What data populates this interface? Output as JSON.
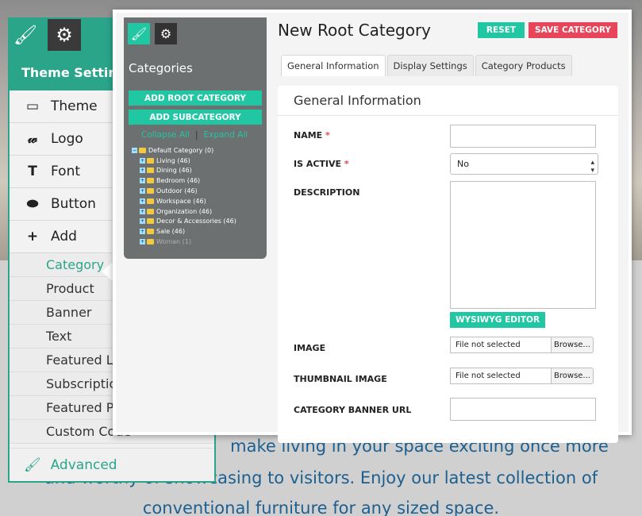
{
  "background": {
    "lines": [
      "make living in your space exciting once more",
      "and worthy of showcasing to visitors. Enjoy our latest collection of",
      "conventional furniture for any sized space."
    ]
  },
  "theme_panel": {
    "title": "Theme Setting",
    "items": [
      {
        "label": "Theme",
        "icon": "layout-icon",
        "glyph": "▭"
      },
      {
        "label": "Logo",
        "icon": "logo-script-icon",
        "glyph": "𝓌"
      },
      {
        "label": "Font",
        "icon": "font-t-icon",
        "glyph": "T"
      },
      {
        "label": "Button",
        "icon": "button-pill-icon",
        "glyph": "⬬"
      },
      {
        "label": "Add",
        "icon": "plus-icon",
        "glyph": "+"
      }
    ],
    "add_items": [
      "Category",
      "Product",
      "Banner",
      "Text",
      "Featured Lo",
      "Subscription",
      "Featured Pr",
      "Custom Code"
    ],
    "advanced_label": "Advanced"
  },
  "popup": {
    "sidebar": {
      "title": "Categories",
      "add_root_label": "ADD ROOT CATEGORY",
      "add_sub_label": "ADD SUBCATEGORY",
      "collapse_label": "Collapse All",
      "separator": "|",
      "expand_label": "Expand All",
      "tree_root": "Default Category (0)",
      "tree_children": [
        "Living (46)",
        "Dining (46)",
        "Bedroom (46)",
        "Outdoor (46)",
        "Workspace (46)",
        "Organization (46)",
        "Decor & Accessories (46)",
        "Sale (46)",
        "Woman (1)"
      ]
    },
    "title": "New Root Category",
    "reset_label": "RESET",
    "save_label": "SAVE CATEGORY",
    "tabs": [
      "General Information",
      "Display Settings",
      "Category Products"
    ],
    "form": {
      "heading": "General Information",
      "name_label": "NAME",
      "required_mark": "*",
      "is_active_label": "IS ACTIVE",
      "is_active_value": "No",
      "description_label": "DESCRIPTION",
      "wysiwyg_label": "WYSIWYG EDITOR",
      "image_label": "IMAGE",
      "thumbnail_label": "THUMBNAIL IMAGE",
      "file_placeholder": "File not selected",
      "browse_label": "Browse...",
      "banner_url_label": "CATEGORY BANNER URL"
    }
  },
  "colors": {
    "accent": "#21c6a3",
    "theme_green": "#2aa58a",
    "danger": "#e8455a",
    "link_blue": "#1d5f8e"
  }
}
